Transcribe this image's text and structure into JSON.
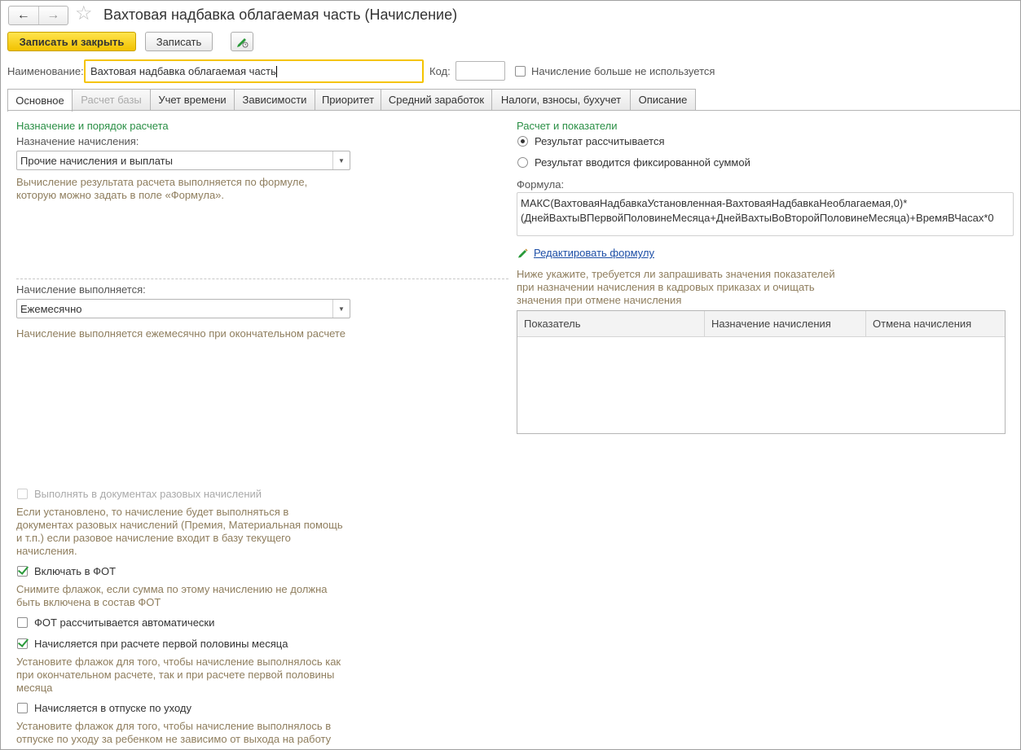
{
  "window": {
    "title": "Вахтовая надбавка облагаемая часть (Начисление)",
    "icons": {
      "back": "back-arrow-icon",
      "forward": "forward-arrow-icon",
      "favorite": "star-icon",
      "edit": "pen-edit-icon"
    }
  },
  "toolbar": {
    "save_close_label": "Записать и закрыть",
    "save_label": "Записать"
  },
  "header": {
    "name_label": "Наименование:",
    "name_value": "Вахтовая надбавка облагаемая часть",
    "code_label": "Код:",
    "code_value": "",
    "not_used_label": "Начисление больше не используется",
    "not_used_checked": false
  },
  "tabs": [
    {
      "label": "Основное",
      "active": true
    },
    {
      "label": "Расчет базы",
      "disabled": true
    },
    {
      "label": "Учет времени"
    },
    {
      "label": "Зависимости"
    },
    {
      "label": "Приоритет"
    },
    {
      "label": "Средний заработок"
    },
    {
      "label": "Налоги, взносы, бухучет"
    },
    {
      "label": "Описание"
    }
  ],
  "left": {
    "section_title": "Назначение и порядок расчета",
    "purpose_label": "Назначение начисления:",
    "purpose_value": "Прочие начисления и выплаты",
    "purpose_hint_1": "Вычисление результата расчета выполняется по формуле,",
    "purpose_hint_2": "которую можно задать в поле «Формула».",
    "frequency_label": "Начисление выполняется:",
    "frequency_value": "Ежемесячно",
    "frequency_hint": "Начисление выполняется ежемесячно при окончательном расчете",
    "one_time_label": "Выполнять в документах разовых начислений",
    "one_time_hint_1": "Если установлено, то начисление будет выполняться в",
    "one_time_hint_2": "документах разовых начислений (Премия, Материальная помощь",
    "one_time_hint_3": "и т.п.) если разовое начисление входит в базу текущего",
    "one_time_hint_4": "начисления.",
    "fot_label": "Включать в ФОТ",
    "fot_hint_1": "Снимите флажок, если сумма по этому начислению не должна",
    "fot_hint_2": "быть включена в состав ФОТ",
    "fot_auto_label": "ФОТ рассчитывается автоматически",
    "first_half_label": "Начисляется при расчете первой половины месяца",
    "first_half_hint_1": "Установите флажок для того, чтобы начисление выполнялось как",
    "first_half_hint_2": "при окончательном расчете, так и при расчете первой половины",
    "first_half_hint_3": "месяца",
    "leave_label": "Начисляется в отпуске по уходу",
    "leave_hint_1": "Установите флажок для того, чтобы начисление выполнялось в",
    "leave_hint_2": "отпуске по уходу за ребенком не зависимо от выхода на работу"
  },
  "right": {
    "section_title": "Расчет и показатели",
    "radio_calc_label": "Результат рассчитывается",
    "radio_fixed_label": "Результат вводится фиксированной суммой",
    "formula_label": "Формула:",
    "formula_line1": "МАКС(ВахтоваяНадбавкаУстановленная-ВахтоваяНадбавкаНеоблагаемая,0)*",
    "formula_line2": "(ДнейВахтыВПервойПоловинеМесяца+ДнейВахтыВоВторойПоловинеМесяца)+ВремяВЧасах*0",
    "edit_formula_link": "Редактировать формулу",
    "indicators_hint_1": "Ниже укажите, требуется ли запрашивать значения показателей",
    "indicators_hint_2": "при назначении начисления в кадровых приказах и очищать",
    "indicators_hint_3": "значения при отмене начисления",
    "table_headers": [
      "Показатель",
      "Назначение начисления",
      "Отмена начисления"
    ]
  }
}
